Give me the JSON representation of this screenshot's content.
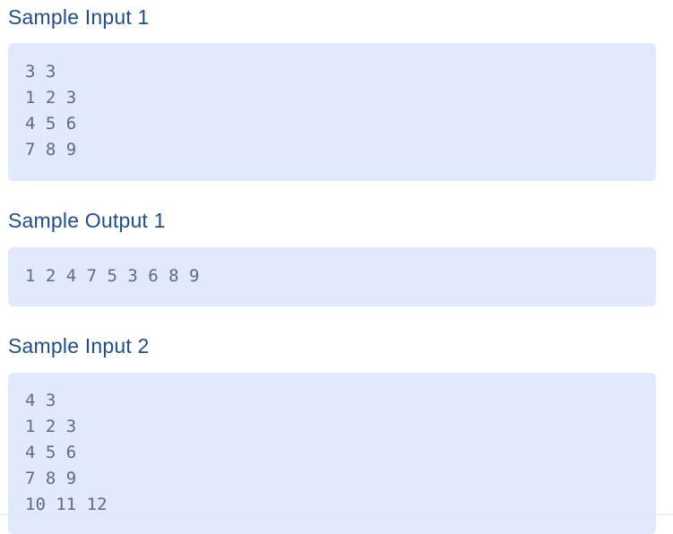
{
  "sections": [
    {
      "heading": "Sample Input 1",
      "code": "3 3\n1 2 3\n4 5 6\n7 8 9"
    },
    {
      "heading": "Sample Output 1",
      "code": "1 2 4 7 5 3 6 8 9"
    },
    {
      "heading": "Sample Input 2",
      "code": "4 3\n1 2 3\n4 5 6\n7 8 9\n10 11 12"
    }
  ],
  "colors": {
    "heading": "#1f4e8c",
    "code_background": "#e1eafd",
    "code_text": "#5f6b7e"
  }
}
